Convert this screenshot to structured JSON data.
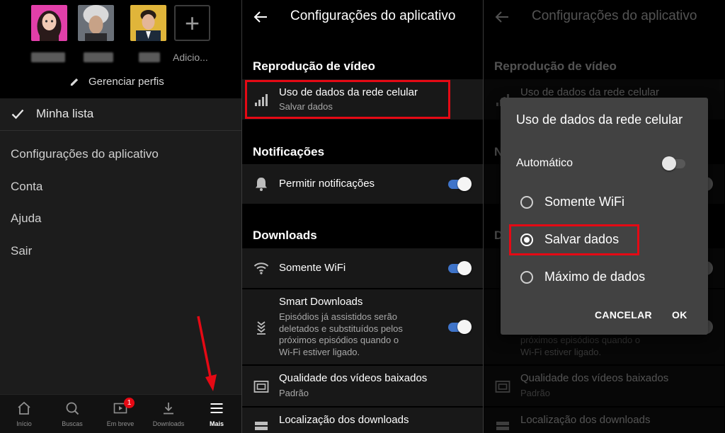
{
  "profiles": {
    "add_label": "Adicio...",
    "manage_label": "Gerenciar perfis"
  },
  "main_menu": {
    "my_list": "Minha lista",
    "items": [
      "Configurações do aplicativo",
      "Conta",
      "Ajuda",
      "Sair"
    ]
  },
  "bottom_nav": {
    "items": [
      {
        "label": "Início",
        "icon": "home-icon"
      },
      {
        "label": "Buscas",
        "icon": "search-icon"
      },
      {
        "label": "Em breve",
        "icon": "coming-soon-icon",
        "badge": "1"
      },
      {
        "label": "Downloads",
        "icon": "download-icon"
      },
      {
        "label": "Mais",
        "icon": "menu-icon",
        "active": true
      }
    ]
  },
  "settings": {
    "title": "Configurações do aplicativo",
    "video_section": "Reprodução de vídeo",
    "cellular_title": "Uso de dados da rede celular",
    "cellular_value": "Salvar dados",
    "notifications_section": "Notificações",
    "allow_notifications": "Permitir notificações",
    "allow_notifications_on": true,
    "downloads_section": "Downloads",
    "wifi_only": "Somente WiFi",
    "wifi_only_on": true,
    "smart_downloads_title": "Smart Downloads",
    "smart_downloads_desc": [
      "Episódios já assistidos serão",
      "deletados e substituídos pelos",
      "próximos episódios quando o",
      "Wi-Fi estiver ligado."
    ],
    "smart_downloads_on": true,
    "quality_title": "Qualidade dos vídeos baixados",
    "quality_value": "Padrão",
    "location_title": "Localização dos downloads"
  },
  "dialog": {
    "title": "Uso de dados da rede celular",
    "auto_label": "Automático",
    "auto_on": false,
    "options": [
      "Somente WiFi",
      "Salvar dados",
      "Máximo de dados"
    ],
    "selected": "Salvar dados",
    "cancel": "CANCELAR",
    "ok": "OK"
  },
  "colors": {
    "highlight": "#e50914",
    "toggle_on": "#3f74c9",
    "dialog_bg": "#424242"
  }
}
